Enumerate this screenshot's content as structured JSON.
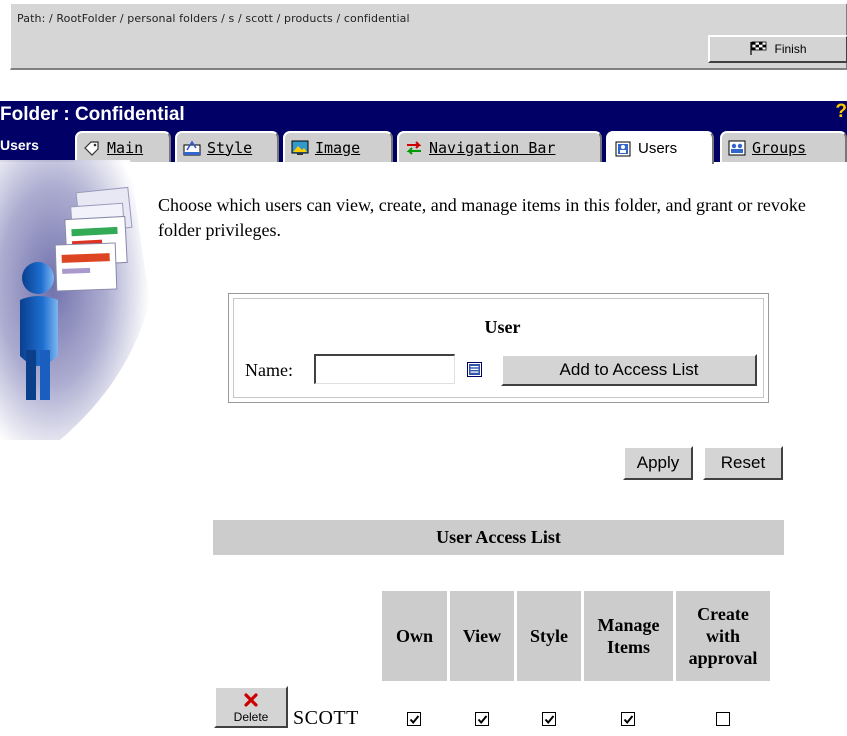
{
  "path": "Path: / RootFolder / personal folders / s / scott / products / confidential",
  "finish_label": "Finish",
  "header": {
    "title": "Folder : Confidential",
    "help": "?",
    "current_section": "Users"
  },
  "tabs": [
    {
      "label": "Main",
      "icon": "tag-icon"
    },
    {
      "label": "Style",
      "icon": "style-icon"
    },
    {
      "label": "Image",
      "icon": "image-icon"
    },
    {
      "label": "Navigation Bar",
      "icon": "navigation-icon"
    },
    {
      "label": "Users",
      "icon": "users-icon",
      "active": true
    },
    {
      "label": "Groups",
      "icon": "groups-icon"
    }
  ],
  "intro": "Choose which users can view, create, and manage items in this folder, and grant or revoke folder privileges.",
  "user_form": {
    "heading": "User",
    "name_label": "Name:",
    "name_value": "",
    "add_label": "Add to Access List"
  },
  "apply_label": "Apply",
  "reset_label": "Reset",
  "access_list": {
    "title": "User Access List",
    "columns": [
      "Own",
      "View",
      "Style",
      "Manage Items",
      "Create with approval"
    ],
    "rows": [
      {
        "user": "SCOTT",
        "delete_label": "Delete",
        "own": true,
        "view": true,
        "style": true,
        "manage_items": true,
        "create_with_approval": false
      }
    ]
  },
  "colors": {
    "header_bg": "#000066",
    "panel_gray": "#cccccc",
    "help_yellow": "#ffcc00",
    "delete_red": "#cc0000"
  }
}
